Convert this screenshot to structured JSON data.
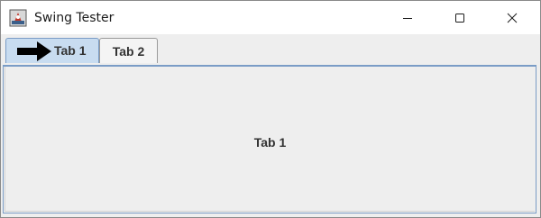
{
  "window": {
    "title": "Swing Tester"
  },
  "tabs": [
    {
      "label": "Tab 1",
      "selected": true
    },
    {
      "label": "Tab 2",
      "selected": false
    }
  ],
  "content": {
    "label": "Tab 1"
  },
  "colors": {
    "selected_tab": "#c8dcf0",
    "tab_border": "#7a9cc6",
    "background": "#eeeeee"
  }
}
